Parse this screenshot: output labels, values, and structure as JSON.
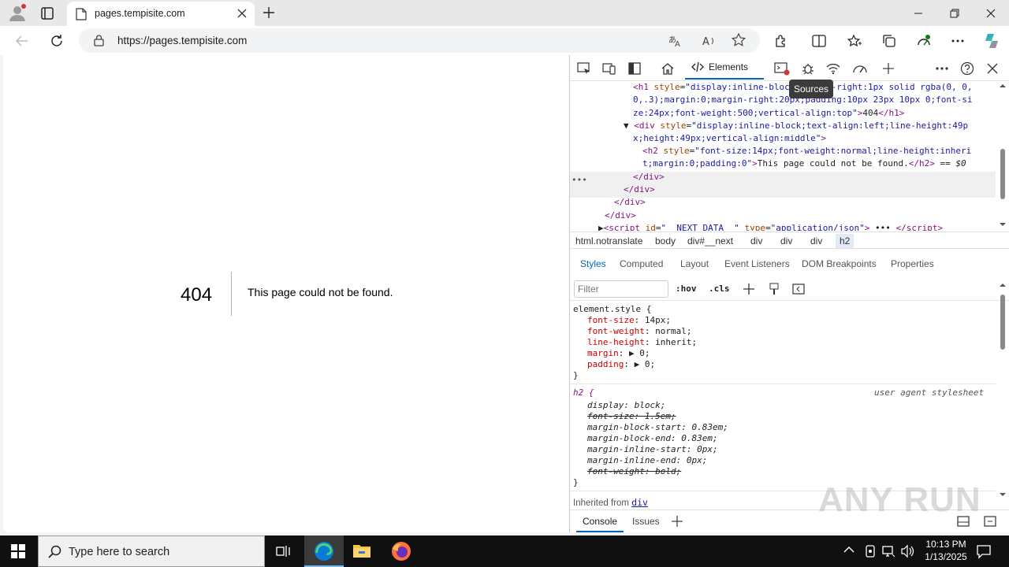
{
  "browser": {
    "tab_title": "pages.tempisite.com",
    "url": "https://pages.tempisite.com"
  },
  "page": {
    "code": "404",
    "message": "This page could not be found."
  },
  "devtools": {
    "elements_tab": "Elements",
    "tooltip": "Sources",
    "dom_lines": [
      {
        "indent": 80,
        "html": "<span class='tg'>&lt;h1</span> <span class='at'>style</span>=<span class='av'>\"display:inline-block;border-right:1px solid rgba(0, 0,</span>"
      },
      {
        "indent": 80,
        "html": "<span class='av'>0,.3);margin:0;margin-right:20px;padding:10px 23px 10px 0;font-si</span>"
      },
      {
        "indent": 80,
        "html": "<span class='av'>ze:24px;font-weight:500;vertical-align:top\"</span><span class='tg'>&gt;</span><span class='tx'>404</span><span class='tg'>&lt;/h1&gt;</span>"
      },
      {
        "indent": 68,
        "html": "<span class='tx'>▼</span> <span class='tg'>&lt;div</span> <span class='at'>style</span>=<span class='av'>\"display:inline-block;text-align:left;line-height:49p</span>"
      },
      {
        "indent": 80,
        "html": "<span class='av'>x;height:49px;vertical-align:middle\"</span><span class='tg'>&gt;</span>"
      },
      {
        "indent": 92,
        "html": "<span class='tg'>&lt;h2</span> <span class='at'>style</span>=<span class='av'>\"font-size:14px;font-weight:normal;line-height:inheri</span>"
      },
      {
        "indent": 92,
        "html": "<span class='av'>t;margin:0;padding:0\"</span><span class='tg'>&gt;</span><span class='tx'>This page could not be found.</span><span class='tg'>&lt;/h2&gt;</span> <span class='tx'>== </span><i class='tx'>$0</i>"
      },
      {
        "indent": 80,
        "html": "<span class='tg'>&lt;/div&gt;</span>"
      },
      {
        "indent": 68,
        "html": "<span class='tg'>&lt;/div&gt;</span>"
      },
      {
        "indent": 56,
        "html": "<span class='tg'>&lt;/div&gt;</span>"
      },
      {
        "indent": 44,
        "html": "<span class='tg'>&lt;/div&gt;</span>"
      },
      {
        "indent": 36,
        "html": "<span class='tx'>▶</span><span class='tg'>&lt;script</span> <span class='at'>id</span>=<span class='av'>\"__NEXT_DATA__\"</span> <span class='at'>type</span>=<span class='av'>\"application/json\"</span><span class='tg'>&gt;</span> ••• <span class='tg'>&lt;/script&gt;</span>"
      }
    ],
    "breadcrumbs": [
      "html.notranslate",
      "body",
      "div#__next",
      "div",
      "div",
      "div",
      "h2"
    ],
    "style_tabs": [
      "Styles",
      "Computed",
      "Layout",
      "Event Listeners",
      "DOM Breakpoints",
      "Properties"
    ],
    "filter_placeholder": "Filter",
    "filter_tools": [
      ":hov",
      ".cls"
    ],
    "element_style_selector": "element.style {",
    "element_style": [
      {
        "prop": "font-size",
        "value": "14px;"
      },
      {
        "prop": "font-weight",
        "value": "normal;"
      },
      {
        "prop": "line-height",
        "value": "inherit;"
      },
      {
        "prop": "margin",
        "value": "▶ 0;"
      },
      {
        "prop": "padding",
        "value": "▶ 0;"
      }
    ],
    "close_brace": "}",
    "ua_selector": "h2 {",
    "ua_label": "user agent stylesheet",
    "ua_rules": [
      {
        "prop": "display",
        "value": "block;",
        "struck": false
      },
      {
        "prop": "font-size",
        "value": "1.5em;",
        "struck": true
      },
      {
        "prop": "margin-block-start",
        "value": "0.83em;",
        "struck": false
      },
      {
        "prop": "margin-block-end",
        "value": "0.83em;",
        "struck": false
      },
      {
        "prop": "margin-inline-start",
        "value": "0px;",
        "struck": false
      },
      {
        "prop": "margin-inline-end",
        "value": "0px;",
        "struck": false
      },
      {
        "prop": "font-weight",
        "value": "bold;",
        "struck": true
      }
    ],
    "inherited_label": "Inherited from",
    "inherited_from": "div",
    "drawer_tabs": [
      "Console",
      "Issues"
    ]
  },
  "taskbar": {
    "search_placeholder": "Type here to search",
    "time": "10:13 PM",
    "date": "1/13/2025"
  },
  "watermark": "ANY RUN"
}
